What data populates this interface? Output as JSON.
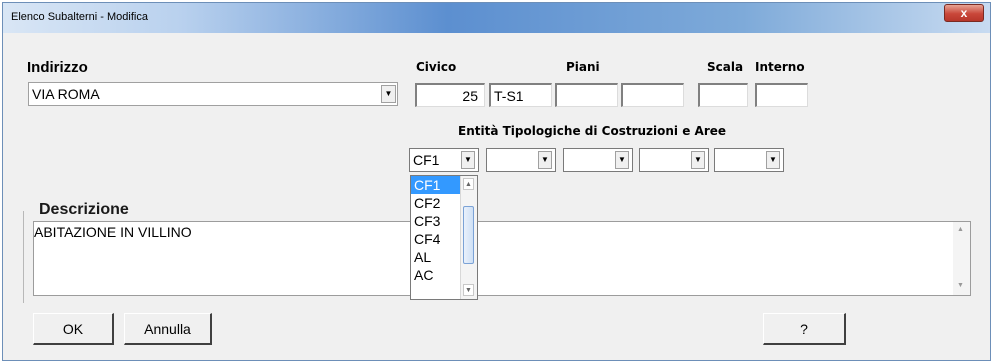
{
  "window": {
    "title": "Elenco Subalterni - Modifica",
    "close_glyph": "x"
  },
  "indirizzo": {
    "label": "Indirizzo",
    "value": "VIA ROMA"
  },
  "civico": {
    "label": "Civico",
    "value": "25"
  },
  "piani": {
    "label": "Piani",
    "values": [
      "T-S1",
      "",
      ""
    ]
  },
  "scala": {
    "label": "Scala",
    "value": ""
  },
  "interno": {
    "label": "Interno",
    "value": ""
  },
  "entita": {
    "label": "Entità Tipologiche di Costruzioni e Aree",
    "combos": [
      "CF1",
      "",
      "",
      "",
      ""
    ],
    "open_list": {
      "items": [
        "CF1",
        "CF2",
        "CF3",
        "CF4",
        "AL",
        "AC"
      ],
      "selected": "CF1"
    }
  },
  "descrizione": {
    "label": "Descrizione",
    "value": "ABITAZIONE IN VILLINO"
  },
  "buttons": {
    "ok": "OK",
    "annulla": "Annulla",
    "help": "?"
  }
}
